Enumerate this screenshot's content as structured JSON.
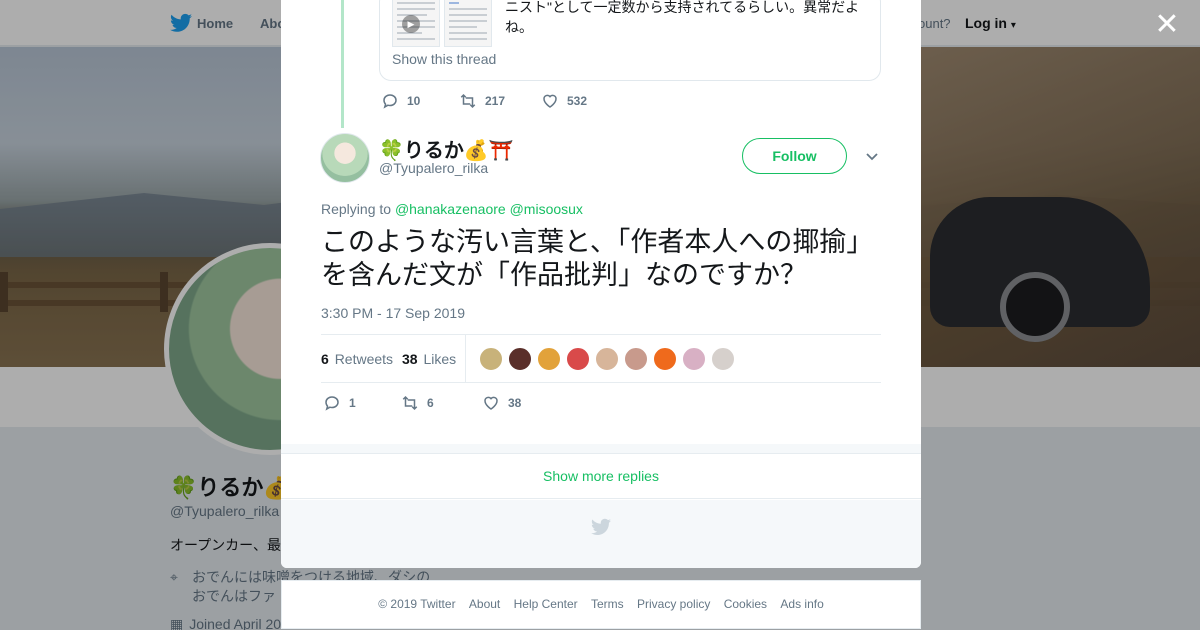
{
  "topnav": {
    "home": "Home",
    "about": "Abo",
    "account": "ccount?",
    "login": "Log in"
  },
  "profile_bg": {
    "name": "🍀りるか💰",
    "handle": "@Tyupalero_rilka",
    "bio": "オープンカー、最",
    "location_line1": "おでんには味噌をつける地域、ダシの",
    "location_line2": "おでんはファ",
    "joined": "Joined April 20"
  },
  "parent_tweet": {
    "text": "ニスト\"として一定数から支持されてるらしい。異常だよね。",
    "show_thread": "Show this thread",
    "replies": "10",
    "retweets": "217",
    "likes": "532"
  },
  "tweet": {
    "author_name": "🍀りるか💰⛩️",
    "author_handle": "@Tyupalero_rilka",
    "follow_label": "Follow",
    "replying_prefix": "Replying to",
    "mention1": "@hanakazenaore",
    "mention2": "@misoosux",
    "text": "このような汚い言葉と、「作者本人への揶揄」を含んだ文が「作品批判」なのですか？",
    "timestamp": "3:30 PM - 17 Sep 2019",
    "retweet_count": "6",
    "retweet_label": "Retweets",
    "like_count": "38",
    "like_label": "Likes",
    "actions": {
      "replies": "1",
      "retweets": "6",
      "likes": "38"
    }
  },
  "likers": [
    "#c8b27a",
    "#5a2f2a",
    "#e2a23a",
    "#d94a4a",
    "#d7b59a",
    "#c89a8c",
    "#ef6a1c",
    "#d8b0c4",
    "#d6d0cc"
  ],
  "show_more": "Show more replies",
  "footer": {
    "links": [
      "© 2019 Twitter",
      "About",
      "Help Center",
      "Terms",
      "Privacy policy",
      "Cookies",
      "Ads info"
    ]
  },
  "colors": {
    "accent": "#17bf63",
    "twitter_blue": "#1da1f2",
    "muted": "#657786"
  },
  "icons": {
    "close": "close-icon",
    "bird": "twitter-bird-icon",
    "reply": "reply-icon",
    "retweet": "retweet-icon",
    "like": "heart-icon",
    "caret": "chevron-down-icon",
    "location": "location-pin-icon",
    "calendar": "calendar-icon"
  }
}
